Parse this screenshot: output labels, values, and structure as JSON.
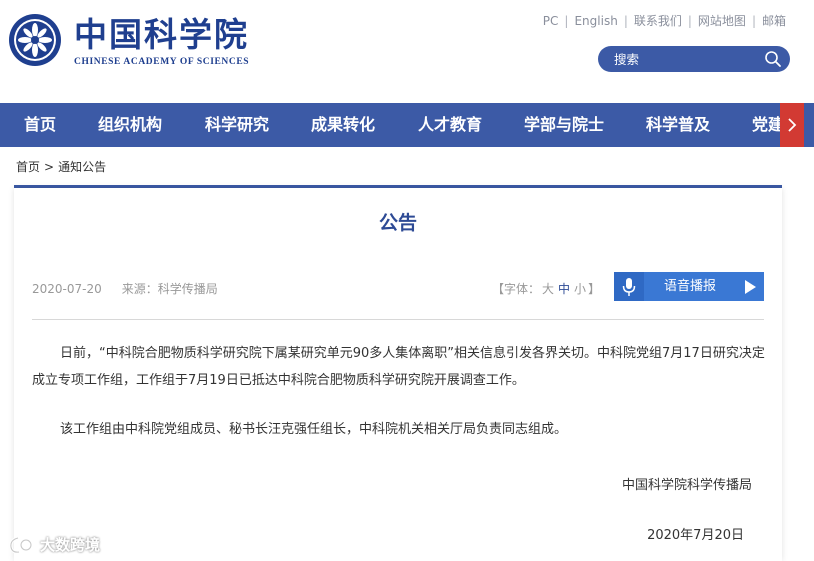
{
  "header": {
    "logo_cn": "中国科学院",
    "logo_en": "CHINESE ACADEMY OF SCIENCES",
    "top_links": [
      "PC",
      "English",
      "联系我们",
      "网站地图",
      "邮箱"
    ],
    "search_placeholder": "搜索"
  },
  "nav": {
    "items": [
      "首页",
      "组织机构",
      "科学研究",
      "成果转化",
      "人才教育",
      "学部与院士",
      "科学普及",
      "党建"
    ]
  },
  "breadcrumb": {
    "home": "首页",
    "separator": ">",
    "current": "通知公告"
  },
  "article": {
    "title": "公告",
    "date": "2020-07-20",
    "source": "来源：科学传播局",
    "font_label_open": "【字体：",
    "font_large": "大",
    "font_medium": "中",
    "font_small": "小",
    "font_label_close": "】",
    "voice_label": "语音播报",
    "paragraph1": "日前，“中科院合肥物质科学研究院下属某研究单元90多人集体离职”相关信息引发各界关切。中科院党组7月17日研究决定成立专项工作组，工作组于7月19日已抵达中科院合肥物质科学研究院开展调查工作。",
    "paragraph2": "该工作组由中科院党组成员、秘书长汪克强任组长，中科院机关相关厅局负责同志组成。",
    "signer": "中国科学院科学传播局",
    "sign_date": "2020年7月20日"
  },
  "watermark": {
    "text": "大数跨境"
  },
  "colors": {
    "primary_blue": "#3c5aa6",
    "title_blue": "#2d4a95",
    "voice_blue": "#3a78d4",
    "accent_red": "#d23a33"
  }
}
